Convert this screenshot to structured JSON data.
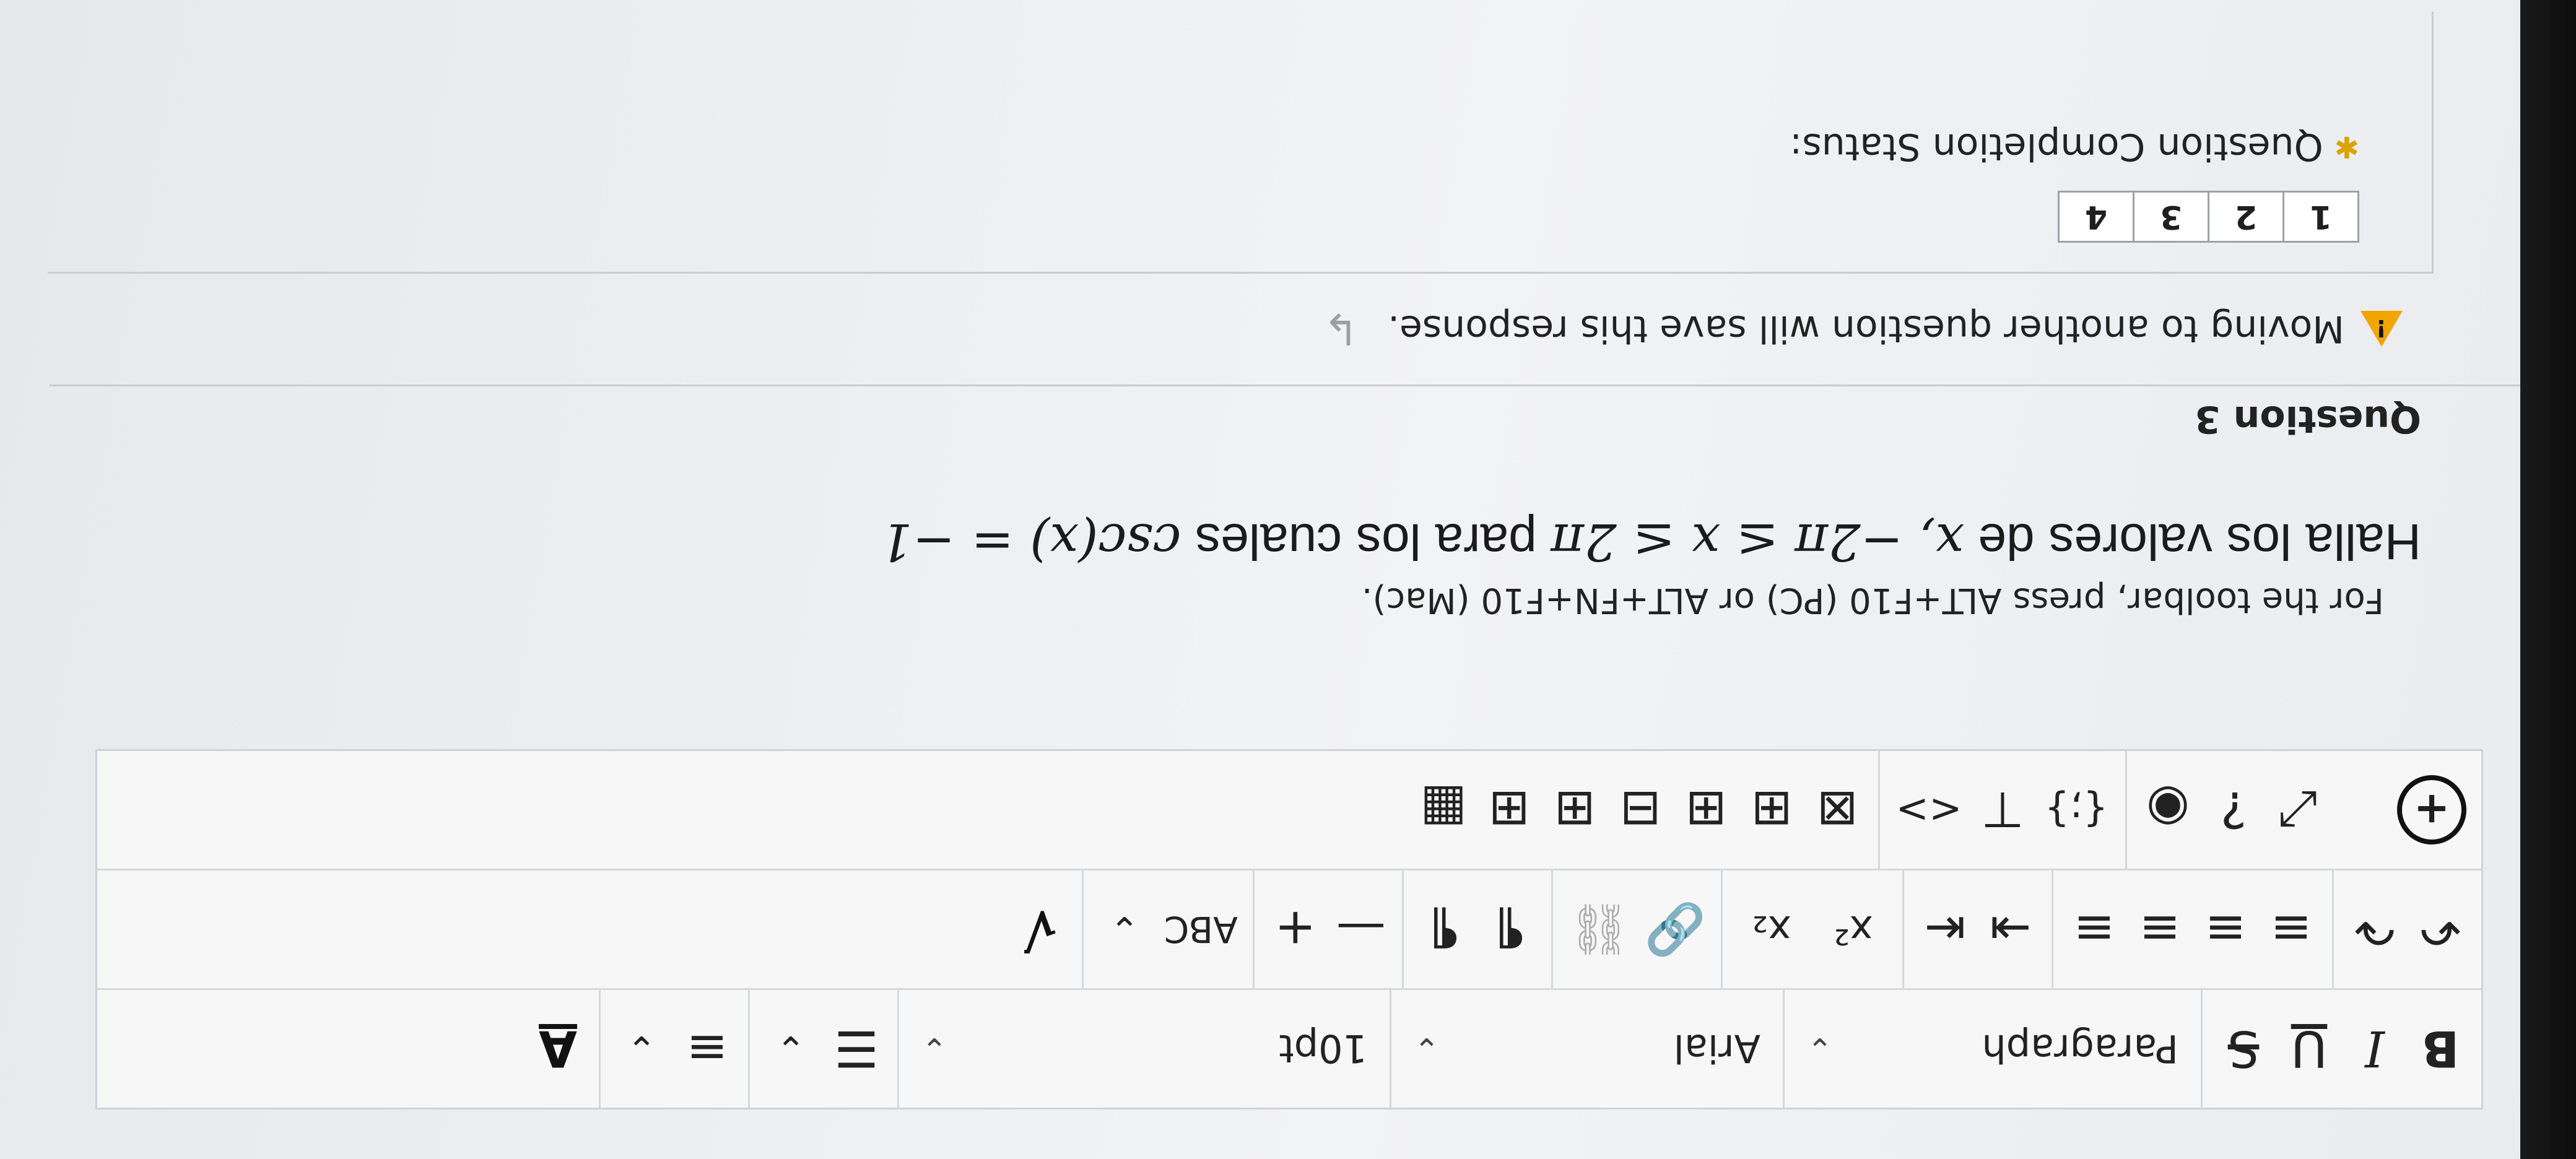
{
  "toolbar": {
    "row1": {
      "bold": "B",
      "italic": "I",
      "underline": "U",
      "strike": "S",
      "block_format": "Paragraph",
      "font_family": "Arial",
      "font_size": "10pt",
      "bullet_list": "☰",
      "numbered_list": "≡",
      "text_color": "A"
    },
    "row2": {
      "undo": "↶",
      "redo": "↷",
      "align_left": "≡",
      "align_center": "≡",
      "align_right": "≡",
      "justify": "≡",
      "indent": "⇥",
      "outdent": "⇤",
      "superscript": "x²",
      "subscript": "x₂",
      "link": "🔗",
      "unlink": "⛓",
      "ltr": "¶",
      "rtl": "¶",
      "hr": "—",
      "insert": "+",
      "spellcheck": "ABC",
      "math": "√"
    },
    "row3": {
      "add": "+",
      "fullscreen": "⤢",
      "help": "?",
      "preview": "◉",
      "source": "{;}",
      "anchor": "⊤",
      "code": "<>",
      "table_tools": [
        "⊠",
        "⊞",
        "⊞",
        "⊟",
        "⊞",
        "⊞",
        "▦"
      ]
    }
  },
  "help_text": "For the toolbar, press ALT+F10 (PC) or ALT+FN+F10 (Mac).",
  "question": {
    "prompt_text": "Halla los valores de ",
    "prompt_math": "x, −2π ≤ x ≤ 2π",
    "prompt_text2": " para los cuales ",
    "prompt_math2": "csc(x) = −1",
    "title": "Question 3"
  },
  "notice": "Moving to another question will save this response.",
  "completion": {
    "label": "Question Completion Status:",
    "pages": [
      "1",
      "2",
      "3",
      "4"
    ]
  }
}
